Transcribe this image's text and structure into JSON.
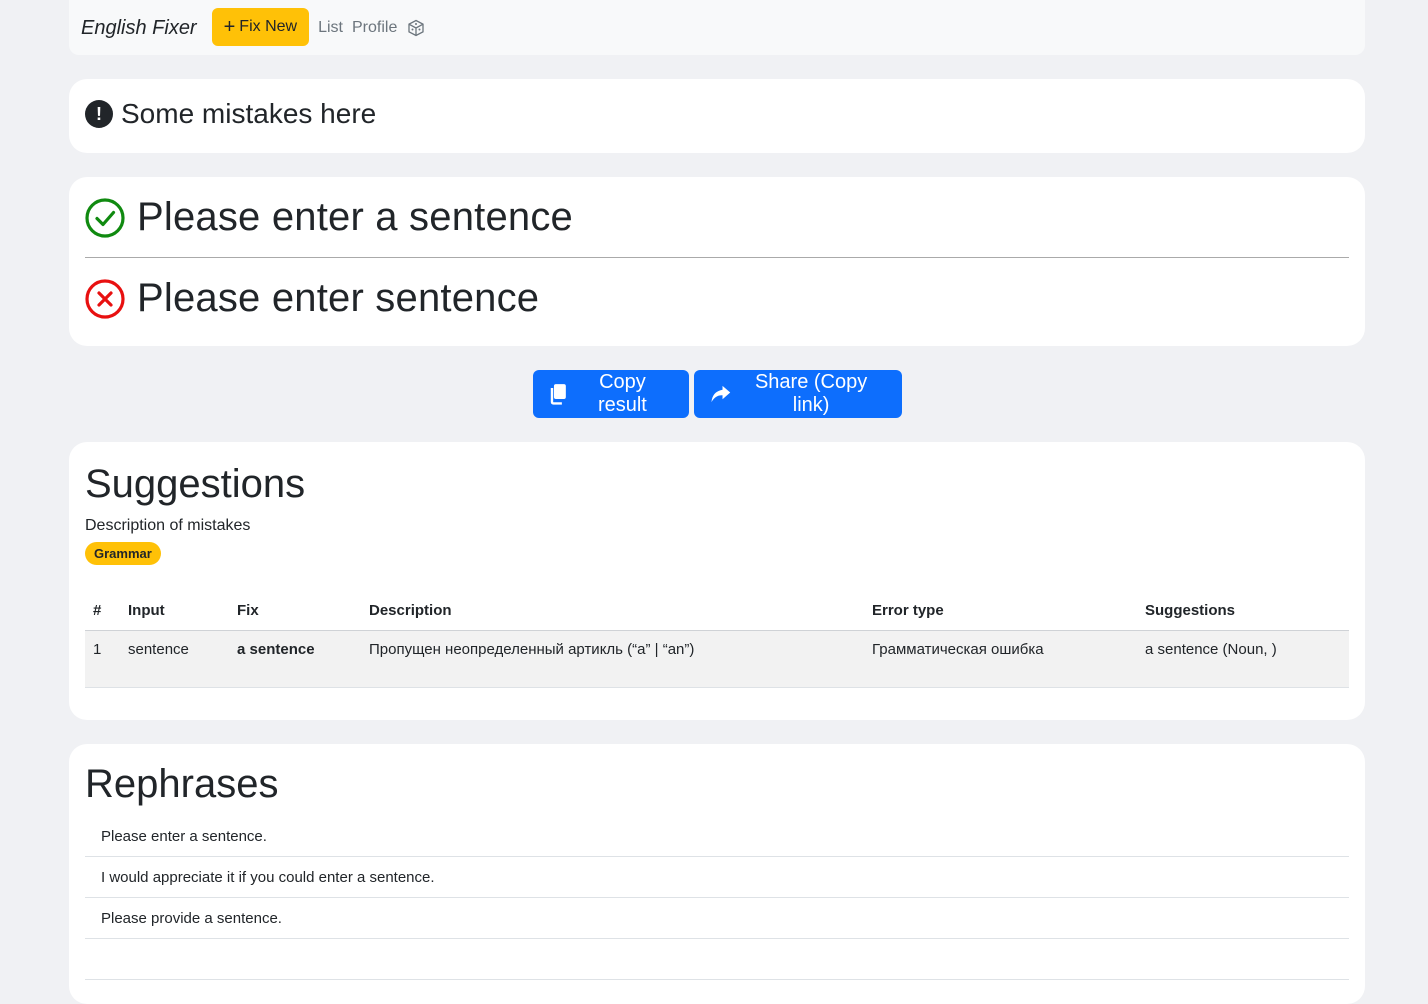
{
  "nav": {
    "brand": "English Fixer",
    "fix_new_label": "Fix New",
    "list_label": "List",
    "profile_label": "Profile"
  },
  "status": {
    "message": "Some mistakes here"
  },
  "comparison": {
    "corrected": "Please enter a sentence",
    "original": "Please enter sentence"
  },
  "actions": {
    "copy_label": "Copy result",
    "share_label": "Share (Copy link)"
  },
  "suggestions": {
    "title": "Suggestions",
    "description": "Description of mistakes",
    "badge": "Grammar",
    "headers": [
      "#",
      "Input",
      "Fix",
      "Description",
      "Error type",
      "Suggestions"
    ],
    "rows": [
      {
        "num": "1",
        "input": "sentence",
        "fix": "a sentence",
        "description": "Пропущен неопределенный артикль (“a” | “an”)",
        "error_type": "Грамматическая ошибка",
        "suggestions": "a sentence (Noun, )"
      }
    ]
  },
  "rephrases": {
    "title": "Rephrases",
    "items": [
      "Please enter a sentence.",
      "I would appreciate it if you could enter a sentence.",
      "Please provide a sentence.",
      ""
    ]
  },
  "colors": {
    "page_bg": "#f0f1f4",
    "warning": "#ffc107",
    "primary": "#0d6efd",
    "success": "#108a10",
    "danger": "#e81010"
  },
  "icons": [
    "plus-icon",
    "cube-icon",
    "exclamation-circle-icon",
    "check-circle-icon",
    "x-circle-icon",
    "copy-icon",
    "share-icon"
  ]
}
